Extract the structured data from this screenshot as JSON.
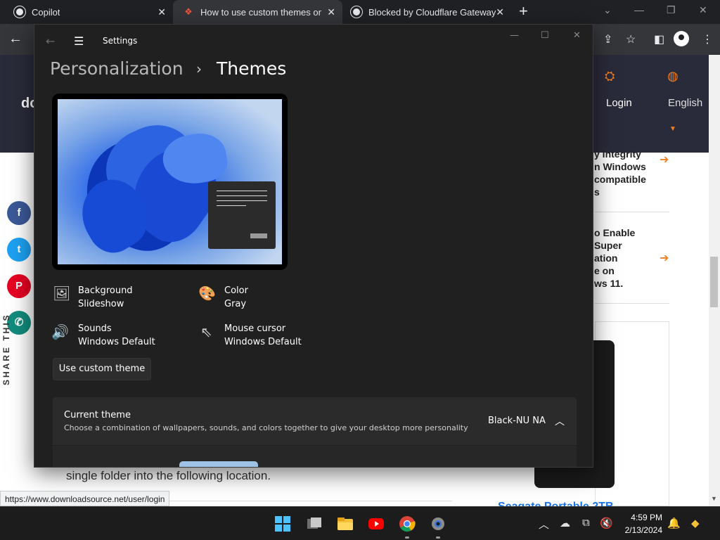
{
  "browser": {
    "tabs": [
      {
        "label": "Copilot",
        "active": false
      },
      {
        "label": "How to use custom themes on W",
        "active": true
      },
      {
        "label": "Blocked by Cloudflare Gateway",
        "active": false
      }
    ],
    "new_tab_label": "+",
    "status_url": "https://www.downloadsource.net/user/login"
  },
  "webpage": {
    "logo_text": "do",
    "login_label": "Login",
    "language_label": "English",
    "share_label": "SHARE THIS",
    "side_articles": [
      {
        "lines": [
          "y Integrity",
          "n Windows",
          "compatible",
          "s"
        ]
      },
      {
        "lines": [
          "o Enable",
          "Super",
          "ation",
          "e on",
          "ws 11."
        ]
      }
    ],
    "article_text": "single folder into the following location.",
    "product_title": "Seagate Portable 2TB"
  },
  "settings": {
    "window_title": "Settings",
    "breadcrumb_parent": "Personalization",
    "breadcrumb_separator": "›",
    "breadcrumb_current": "Themes",
    "properties": [
      {
        "name": "Background",
        "value": "Slideshow",
        "icon": "image-icon"
      },
      {
        "name": "Color",
        "value": "Gray",
        "icon": "palette-icon"
      },
      {
        "name": "Sounds",
        "value": "Windows Default",
        "icon": "speaker-icon"
      },
      {
        "name": "Mouse cursor",
        "value": "Windows Default",
        "icon": "cursor-icon"
      }
    ],
    "custom_theme_button": "Use custom theme",
    "current_theme": {
      "title": "Current theme",
      "description": "Choose a combination of wallpapers, sounds, and colors together to give your desktop more personality",
      "value": "Black-NU NA"
    }
  },
  "taskbar": {
    "time": "4:59 PM",
    "date": "2/13/2024"
  },
  "colors": {
    "accent_orange": "#f38020",
    "settings_bg": "#202020",
    "wallpaper_blue": "#2f6be8"
  }
}
